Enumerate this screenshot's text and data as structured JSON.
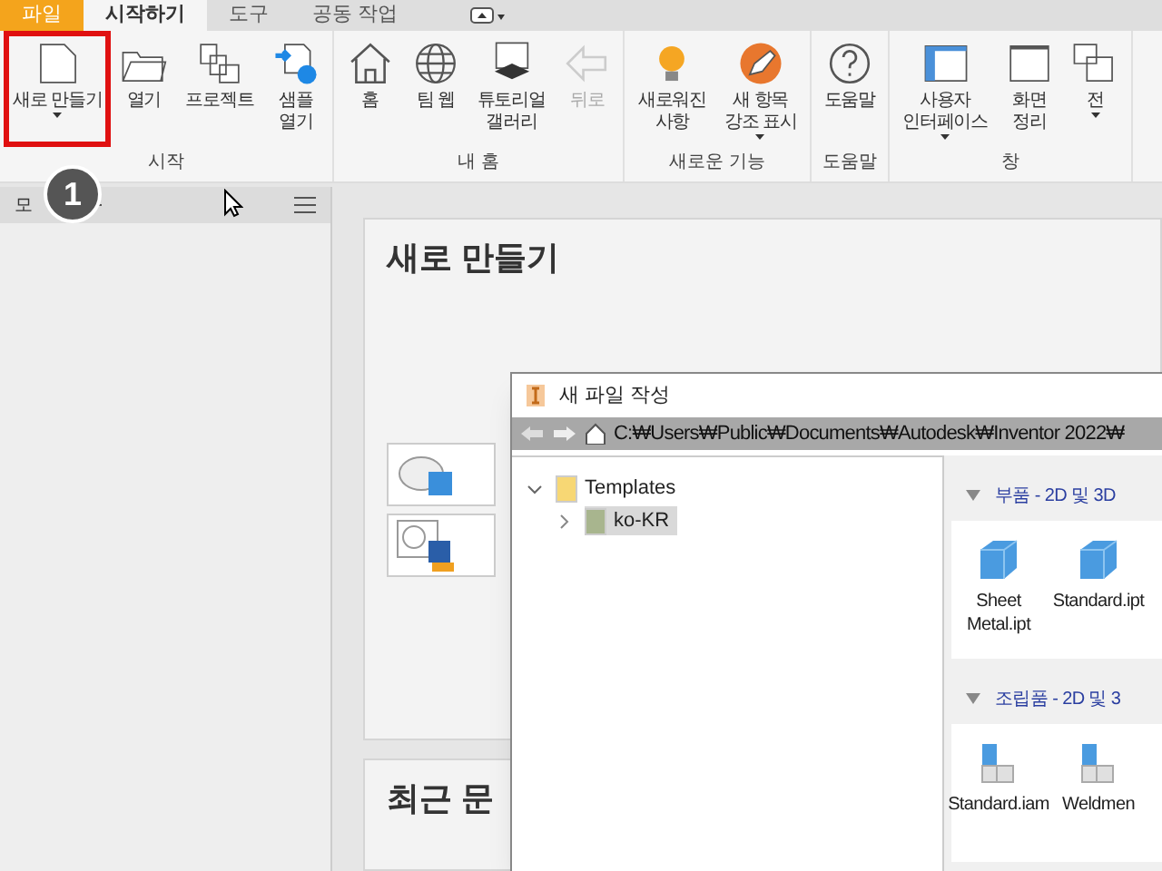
{
  "ribbon_tabs": [
    {
      "label": "파일",
      "kind": "file",
      "selected": false
    },
    {
      "label": "시작하기",
      "kind": "tab",
      "selected": true
    },
    {
      "label": "도구",
      "kind": "tab",
      "selected": false
    },
    {
      "label": "공동 작업",
      "kind": "tab",
      "selected": false
    }
  ],
  "groups": [
    {
      "label": "시작",
      "buttons": [
        {
          "label": "새로 만들기",
          "dropdown": true,
          "highlighted": true,
          "disabled": false
        },
        {
          "label": "열기",
          "dropdown": false,
          "highlighted": false,
          "disabled": false
        },
        {
          "label": "프로젝트",
          "dropdown": false,
          "highlighted": false,
          "disabled": false
        },
        {
          "label": "샘플\n열기",
          "dropdown": false,
          "highlighted": false,
          "disabled": false
        }
      ]
    },
    {
      "label": "내 홈",
      "buttons": [
        {
          "label": "홈",
          "dropdown": false,
          "highlighted": false,
          "disabled": false
        },
        {
          "label": "팀 웹",
          "dropdown": false,
          "highlighted": false,
          "disabled": false
        },
        {
          "label": "튜토리얼\n갤러리",
          "dropdown": false,
          "highlighted": false,
          "disabled": false
        },
        {
          "label": "뒤로",
          "dropdown": false,
          "highlighted": false,
          "disabled": true
        }
      ]
    },
    {
      "label": "새로운 기능",
      "buttons": [
        {
          "label": "새로워진\n사항",
          "dropdown": false,
          "highlighted": false,
          "disabled": false
        },
        {
          "label": "새 항목\n강조 표시",
          "dropdown": true,
          "highlighted": false,
          "disabled": false
        }
      ]
    },
    {
      "label": "도움말",
      "buttons": [
        {
          "label": "도움말",
          "dropdown": false,
          "highlighted": false,
          "disabled": false
        }
      ]
    },
    {
      "label": "창",
      "buttons": [
        {
          "label": "사용자\n인터페이스",
          "dropdown": true,
          "highlighted": false,
          "disabled": false
        },
        {
          "label": "화면\n정리",
          "dropdown": false,
          "highlighted": false,
          "disabled": false
        },
        {
          "label": "전",
          "dropdown": true,
          "highlighted": false,
          "disabled": false
        }
      ]
    }
  ],
  "browser_panel": {
    "title": "모"
  },
  "step_badge": "1",
  "new_card": {
    "title": "새로 만들기"
  },
  "recent_card": {
    "title": "최근 문"
  },
  "dialog": {
    "title": "새 파일 작성",
    "path": "C:₩Users₩Public₩Documents₩Autodesk₩Inventor 2022₩",
    "tree": [
      {
        "label": "Templates",
        "expanded": true,
        "children": [
          {
            "label": "ko-KR",
            "selected": true,
            "expanded": false
          }
        ]
      }
    ],
    "sections": [
      {
        "title": "부품 - 2D 및 3D",
        "files": [
          {
            "name": "Sheet\nMetal.ipt",
            "kind": "part"
          },
          {
            "name": "Standard.ipt",
            "kind": "part"
          }
        ]
      },
      {
        "title": "조립품 - 2D 및 3",
        "files": [
          {
            "name": "Standard.iam",
            "kind": "assembly"
          },
          {
            "name": "Weldmen",
            "kind": "assembly"
          }
        ]
      }
    ]
  }
}
